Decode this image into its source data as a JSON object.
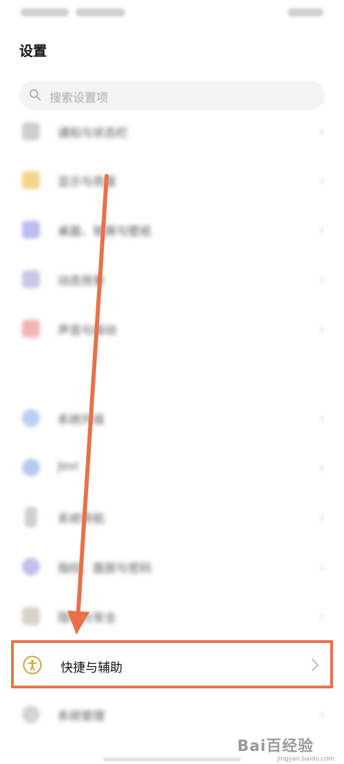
{
  "header": {
    "title": "设置"
  },
  "search": {
    "placeholder": "搜索设置项"
  },
  "menu": {
    "items": [
      {
        "label": "通知与状态栏",
        "icon": "notification-icon",
        "color": "#cfcfcf"
      },
      {
        "label": "显示与亮度",
        "icon": "display-icon",
        "color": "#f2d58a"
      },
      {
        "label": "桌面、锁屏与壁纸",
        "icon": "wallpaper-icon",
        "color": "#bcbcf0"
      },
      {
        "label": "动态效果",
        "icon": "dynamic-effect-icon",
        "color": "#c7c9e8"
      },
      {
        "label": "声音与振动",
        "icon": "sound-icon",
        "color": "#f2b5b5"
      },
      {
        "label": "系统升级",
        "icon": "update-icon",
        "color": "#b8d0f2"
      },
      {
        "label": "Jovi",
        "icon": "jovi-icon",
        "color": "#b8c9ef"
      },
      {
        "label": "系统导航",
        "icon": "navigation-icon",
        "color": "#d0d0d0"
      },
      {
        "label": "指纹、面部与密码",
        "icon": "fingerprint-icon",
        "color": "#c0c0ec"
      },
      {
        "label": "隐私与安全",
        "icon": "privacy-icon",
        "color": "#d8d2c8"
      },
      {
        "label": "系统管理",
        "icon": "system-management-icon",
        "color": "#d4d4d4"
      }
    ],
    "highlighted": {
      "label": "快捷与辅助",
      "icon": "accessibility-icon",
      "color": "#c99a2e"
    }
  },
  "annotation": {
    "arrow_color": "#e8714a"
  },
  "watermark": {
    "text": "Bai百经验",
    "sub": "jingyan.baidu.com"
  }
}
